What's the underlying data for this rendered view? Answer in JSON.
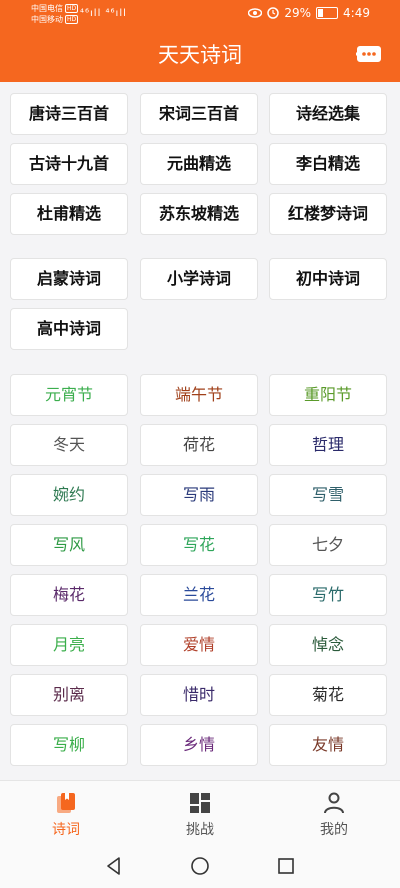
{
  "status_bar": {
    "carrier1": "中国电信",
    "carrier2": "中国移动",
    "hd": "HD",
    "signal": "⁴⁶ıll ⁴⁶ıll",
    "battery_text": "29%",
    "battery_level": 0.29,
    "time": "4:49"
  },
  "app": {
    "title": "天天诗词",
    "more_icon": "ellipsis-bubble-icon",
    "accent": "#f5671f"
  },
  "collections": [
    "唐诗三百首",
    "宋词三百首",
    "诗经选集",
    "古诗十九首",
    "元曲精选",
    "李白精选",
    "杜甫精选",
    "苏东坡精选",
    "红楼梦诗词"
  ],
  "school": [
    "启蒙诗词",
    "小学诗词",
    "初中诗词",
    "高中诗词"
  ],
  "topics": [
    {
      "label": "元宵节",
      "color": "#3cae4e"
    },
    {
      "label": "端午节",
      "color": "#a0401a"
    },
    {
      "label": "重阳节",
      "color": "#5a9a2a"
    },
    {
      "label": "冬天",
      "color": "#555555"
    },
    {
      "label": "荷花",
      "color": "#444444"
    },
    {
      "label": "哲理",
      "color": "#2a2a6a"
    },
    {
      "label": "婉约",
      "color": "#2f7a52"
    },
    {
      "label": "写雨",
      "color": "#2a3a7a"
    },
    {
      "label": "写雪",
      "color": "#2f5f6a"
    },
    {
      "label": "写风",
      "color": "#2e9a44"
    },
    {
      "label": "写花",
      "color": "#2ea55a"
    },
    {
      "label": "七夕",
      "color": "#555555"
    },
    {
      "label": "梅花",
      "color": "#5a2a6a"
    },
    {
      "label": "兰花",
      "color": "#2a4a9a"
    },
    {
      "label": "写竹",
      "color": "#2a6a6a"
    },
    {
      "label": "月亮",
      "color": "#3aae4a"
    },
    {
      "label": "爱情",
      "color": "#b0402a"
    },
    {
      "label": "悼念",
      "color": "#2a5a3a"
    },
    {
      "label": "别离",
      "color": "#5a2a4a"
    },
    {
      "label": "惜时",
      "color": "#3a2a6a"
    },
    {
      "label": "菊花",
      "color": "#2a2a2a"
    },
    {
      "label": "写柳",
      "color": "#3aae4a"
    },
    {
      "label": "乡情",
      "color": "#6a2a7a"
    },
    {
      "label": "友情",
      "color": "#7a3a2a"
    }
  ],
  "bottom_nav": [
    {
      "label": "诗词",
      "icon": "book-icon",
      "active": true
    },
    {
      "label": "挑战",
      "icon": "grid-icon",
      "active": false
    },
    {
      "label": "我的",
      "icon": "person-icon",
      "active": false
    }
  ]
}
